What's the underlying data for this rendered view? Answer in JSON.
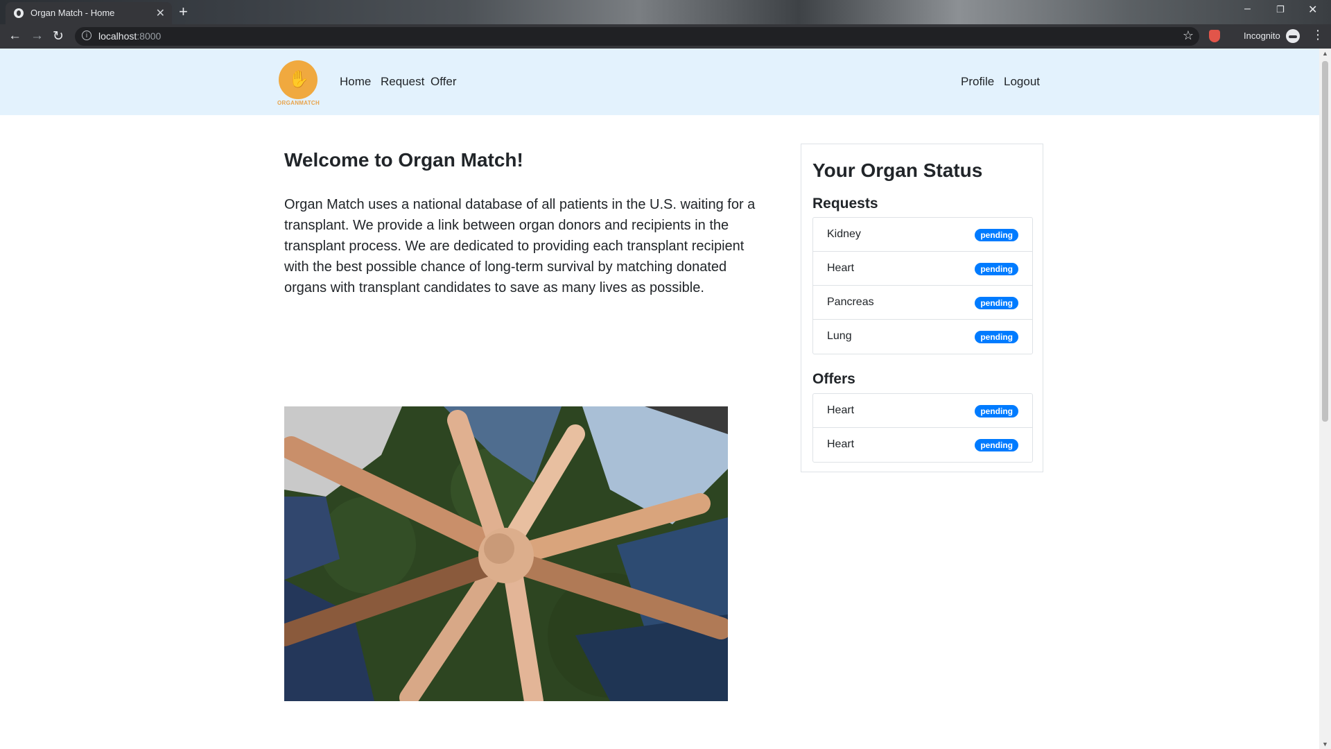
{
  "browser": {
    "tab_title": "Organ Match - Home",
    "url_host": "localhost",
    "url_port": ":8000",
    "incognito_label": "Incognito"
  },
  "navbar": {
    "logo_text": "ORGANMATCH",
    "links": [
      "Home",
      "Request",
      "Offer"
    ],
    "right_links": [
      "Profile",
      "Logout"
    ]
  },
  "main": {
    "heading": "Welcome to Organ Match!",
    "intro": "Organ Match uses a national database of all patients in the U.S. waiting for a transplant. We provide a link between organ donors and recipients in the transplant process. We are dedicated to providing each transplant recipient with the best possible chance of long-term survival by matching donated organs with transplant candidates to save as many lives as possible."
  },
  "status": {
    "title": "Your Organ Status",
    "requests_title": "Requests",
    "requests": [
      {
        "organ": "Kidney",
        "status": "pending"
      },
      {
        "organ": "Heart",
        "status": "pending"
      },
      {
        "organ": "Pancreas",
        "status": "pending"
      },
      {
        "organ": "Lung",
        "status": "pending"
      }
    ],
    "offers_title": "Offers",
    "offers": [
      {
        "organ": "Heart",
        "status": "pending"
      },
      {
        "organ": "Heart",
        "status": "pending"
      }
    ]
  },
  "colors": {
    "navbar_bg": "#e3f2fd",
    "badge": "#007bff",
    "logo": "#f0a93f"
  }
}
